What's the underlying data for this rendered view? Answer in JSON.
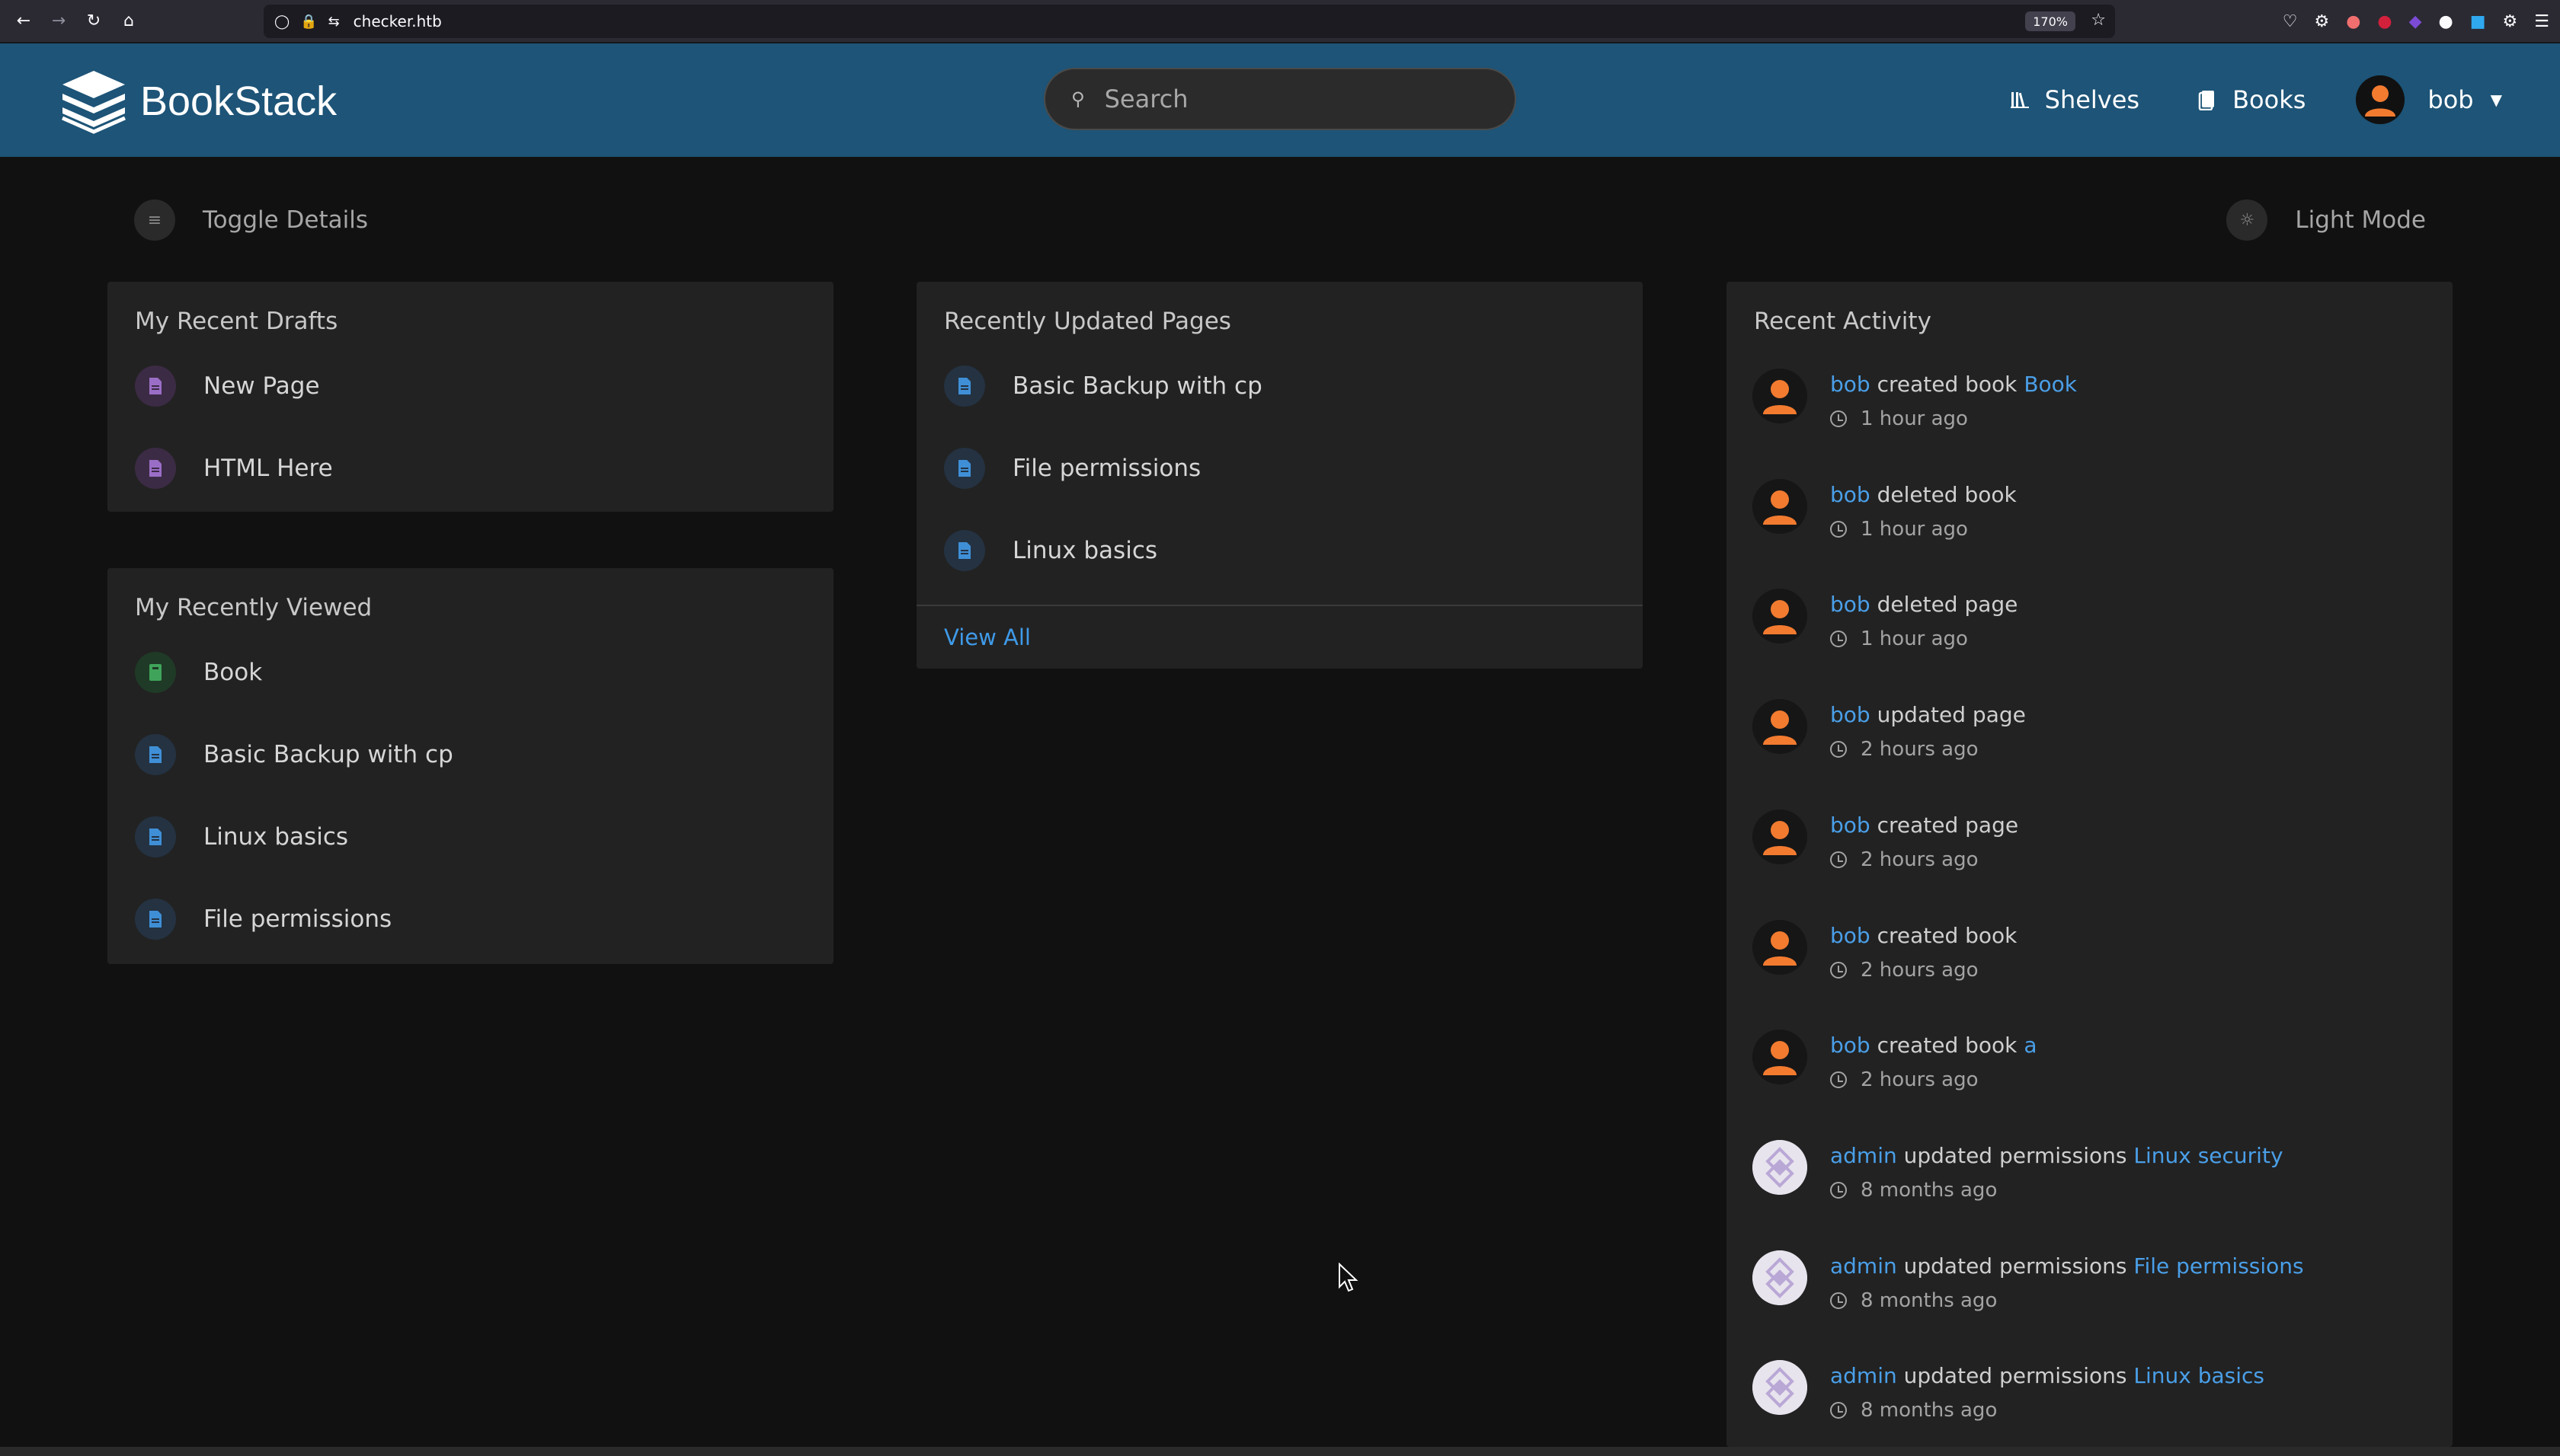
{
  "browser": {
    "url": "checker.htb",
    "zoom": "170%"
  },
  "header": {
    "app_name": "BookStack",
    "search_placeholder": "Search",
    "nav": [
      {
        "label": "Shelves",
        "icon": "shelves-icon"
      },
      {
        "label": "Books",
        "icon": "books-icon"
      }
    ],
    "user": {
      "name": "bob"
    }
  },
  "toolbar": {
    "toggle_details_label": "Toggle Details",
    "light_mode_label": "Light Mode"
  },
  "recent_drafts": {
    "title": "My Recent Drafts",
    "items": [
      {
        "name": "New Page",
        "type": "page-draft"
      },
      {
        "name": "HTML Here",
        "type": "page-draft"
      }
    ]
  },
  "recently_viewed": {
    "title": "My Recently Viewed",
    "items": [
      {
        "name": "Book",
        "type": "book"
      },
      {
        "name": "Basic Backup with cp",
        "type": "page"
      },
      {
        "name": "Linux basics",
        "type": "page"
      },
      {
        "name": "File permissions",
        "type": "page"
      }
    ]
  },
  "recently_updated": {
    "title": "Recently Updated Pages",
    "items": [
      {
        "name": "Basic Backup with cp",
        "type": "page"
      },
      {
        "name": "File permissions",
        "type": "page"
      },
      {
        "name": "Linux basics",
        "type": "page"
      }
    ],
    "view_all_label": "View All"
  },
  "recent_activity": {
    "title": "Recent Activity",
    "items": [
      {
        "user": "bob",
        "action": "created book",
        "target": "Book",
        "time": "1 hour ago",
        "avatar": "bob"
      },
      {
        "user": "bob",
        "action": "deleted book",
        "target": "",
        "time": "1 hour ago",
        "avatar": "bob"
      },
      {
        "user": "bob",
        "action": "deleted page",
        "target": "",
        "time": "1 hour ago",
        "avatar": "bob"
      },
      {
        "user": "bob",
        "action": "updated page",
        "target": "",
        "time": "2 hours ago",
        "avatar": "bob"
      },
      {
        "user": "bob",
        "action": "created page",
        "target": "",
        "time": "2 hours ago",
        "avatar": "bob"
      },
      {
        "user": "bob",
        "action": "created book",
        "target": "",
        "time": "2 hours ago",
        "avatar": "bob"
      },
      {
        "user": "bob",
        "action": "created book",
        "target": "a",
        "time": "2 hours ago",
        "avatar": "bob"
      },
      {
        "user": "admin",
        "action": "updated permissions",
        "target": "Linux security",
        "time": "8 months ago",
        "avatar": "admin"
      },
      {
        "user": "admin",
        "action": "updated permissions",
        "target": "File permissions",
        "time": "8 months ago",
        "avatar": "admin"
      },
      {
        "user": "admin",
        "action": "updated permissions",
        "target": "Linux basics",
        "time": "8 months ago",
        "avatar": "admin"
      }
    ]
  },
  "colors": {
    "header_bg": "#1d5477",
    "page_bg": "#111111",
    "card_bg": "#222222",
    "link": "#4a9fe8",
    "avatar_orange": "#f27b30"
  }
}
